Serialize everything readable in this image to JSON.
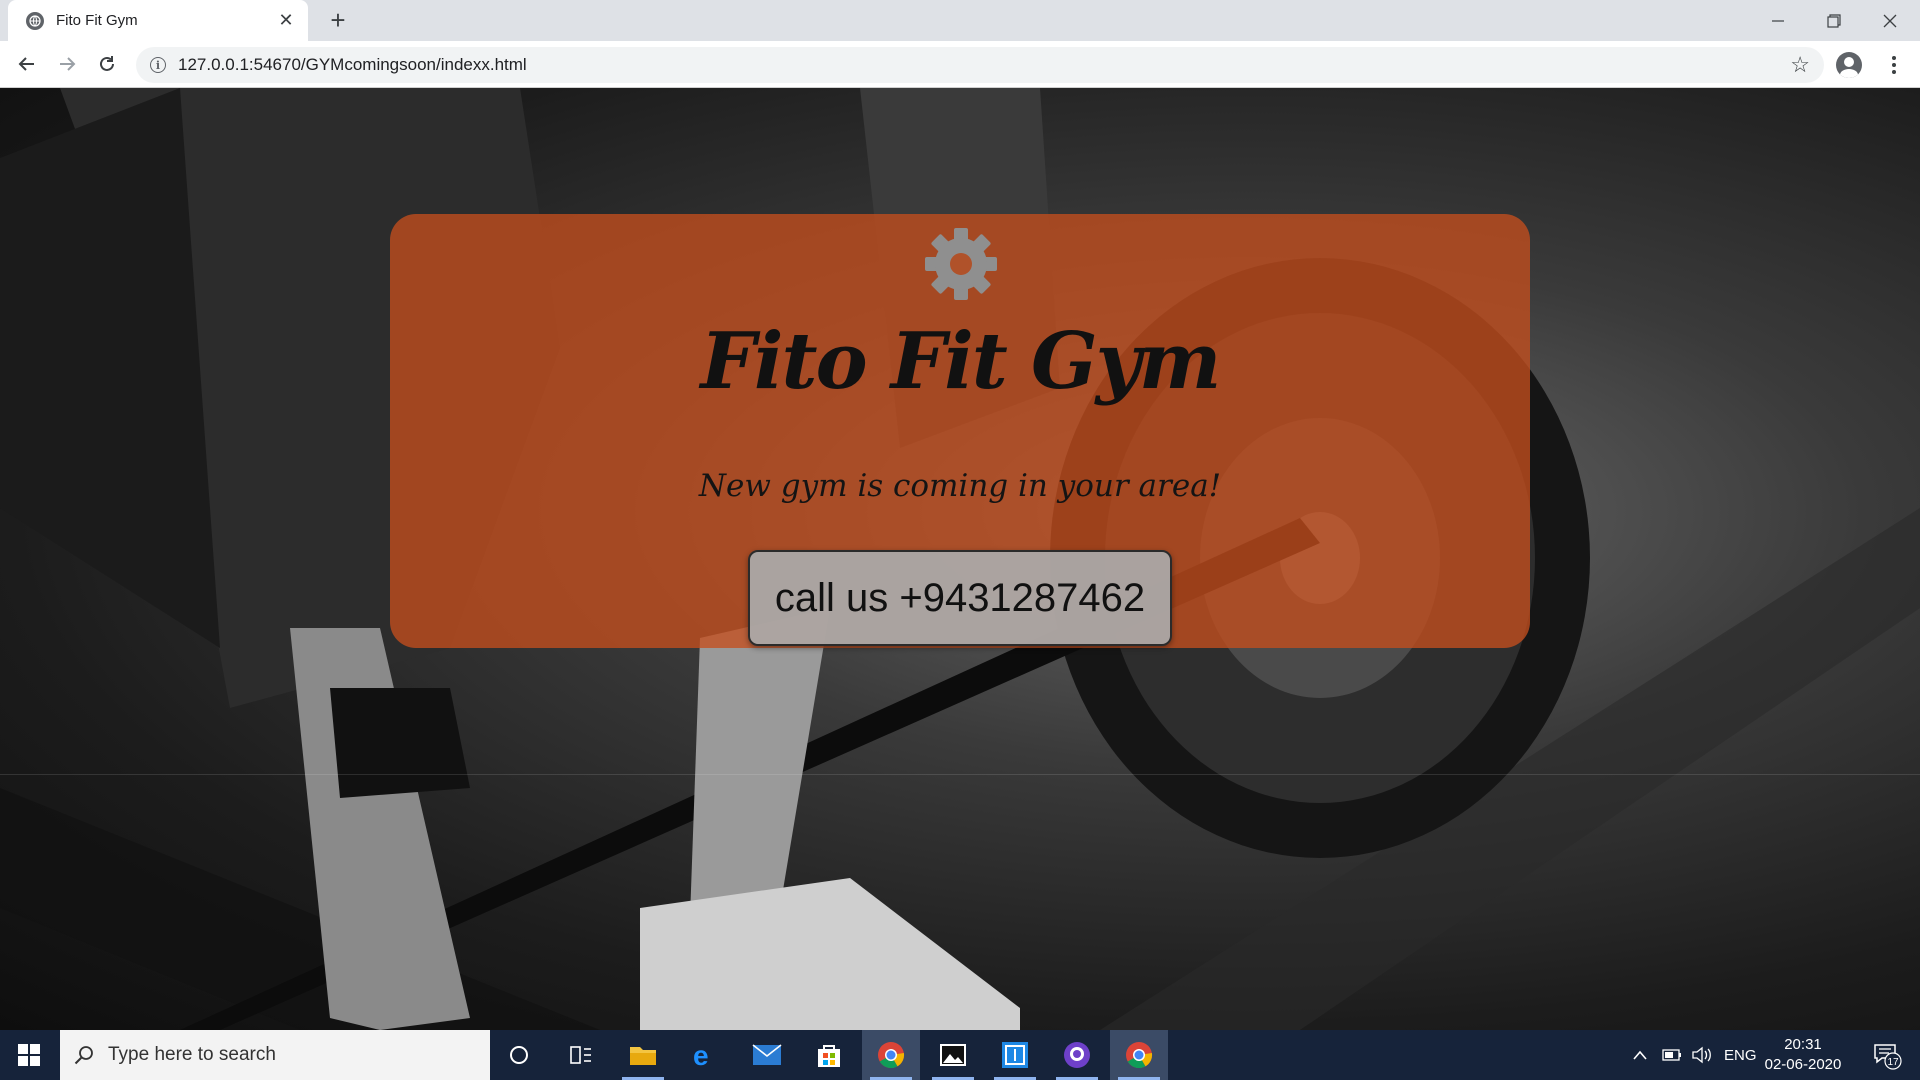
{
  "browser": {
    "tab_title": "Fito Fit Gym",
    "tab_close": "✕",
    "new_tab": "+",
    "url": "127.0.0.1:54670/GYMcomingsoon/indexx.html",
    "bookmark_star": "☆"
  },
  "page": {
    "brand": "Fito Fit Gym",
    "tagline": "New gym is coming in your area!",
    "call_button": "call us +9431287462",
    "card_color": "#c44e1e"
  },
  "taskbar": {
    "search_placeholder": "Type here to search",
    "language": "ENG",
    "time": "20:31",
    "date": "02-06-2020",
    "notification_count": "17",
    "pinned_apps": [
      "cortana-icon",
      "task-view-icon",
      "file-explorer-icon",
      "edge-icon",
      "mail-icon",
      "store-icon",
      "chrome-icon",
      "photos-icon",
      "app-icon",
      "github-icon",
      "chrome-icon"
    ]
  }
}
